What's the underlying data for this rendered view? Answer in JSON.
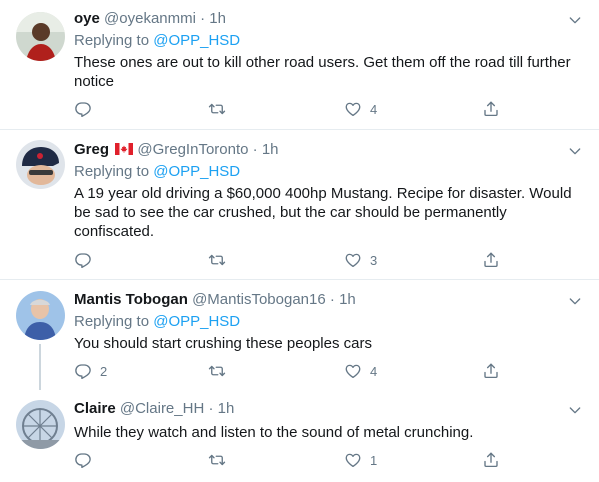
{
  "tweets": [
    {
      "name": "oye",
      "handle": "@oyekanmmi",
      "sep": "·",
      "time": "1h",
      "replying_label": "Replying to",
      "replying_to": "@OPP_HSD",
      "text": "These ones are out to kill other road users. Get them off the road till further notice",
      "reply_count": "",
      "retweet_count": "",
      "like_count": "4"
    },
    {
      "name": "Greg",
      "flag": "canada-flag-icon",
      "handle": "@GregInToronto",
      "sep": "·",
      "time": "1h",
      "replying_label": "Replying to",
      "replying_to": "@OPP_HSD",
      "text": "A 19 year old driving a $60,000 400hp Mustang. Recipe for disaster. Would be sad to see the car crushed, but the car should be permanently confiscated.",
      "reply_count": "",
      "retweet_count": "",
      "like_count": "3"
    },
    {
      "name": "Mantis Tobogan",
      "handle": "@MantisTobogan16",
      "sep": "·",
      "time": "1h",
      "replying_label": "Replying to",
      "replying_to": "@OPP_HSD",
      "text": "You should start crushing these peoples cars",
      "reply_count": "2",
      "retweet_count": "",
      "like_count": "4"
    },
    {
      "name": "Claire",
      "handle": "@Claire_HH",
      "sep": "·",
      "time": "1h",
      "text": "While they watch and listen to the sound of metal crunching.",
      "reply_count": "",
      "retweet_count": "",
      "like_count": "1"
    }
  ],
  "colors": {
    "link": "#1da1f2",
    "muted": "#657786",
    "divider": "#e6ecf0",
    "canada_red": "#e0202b"
  }
}
